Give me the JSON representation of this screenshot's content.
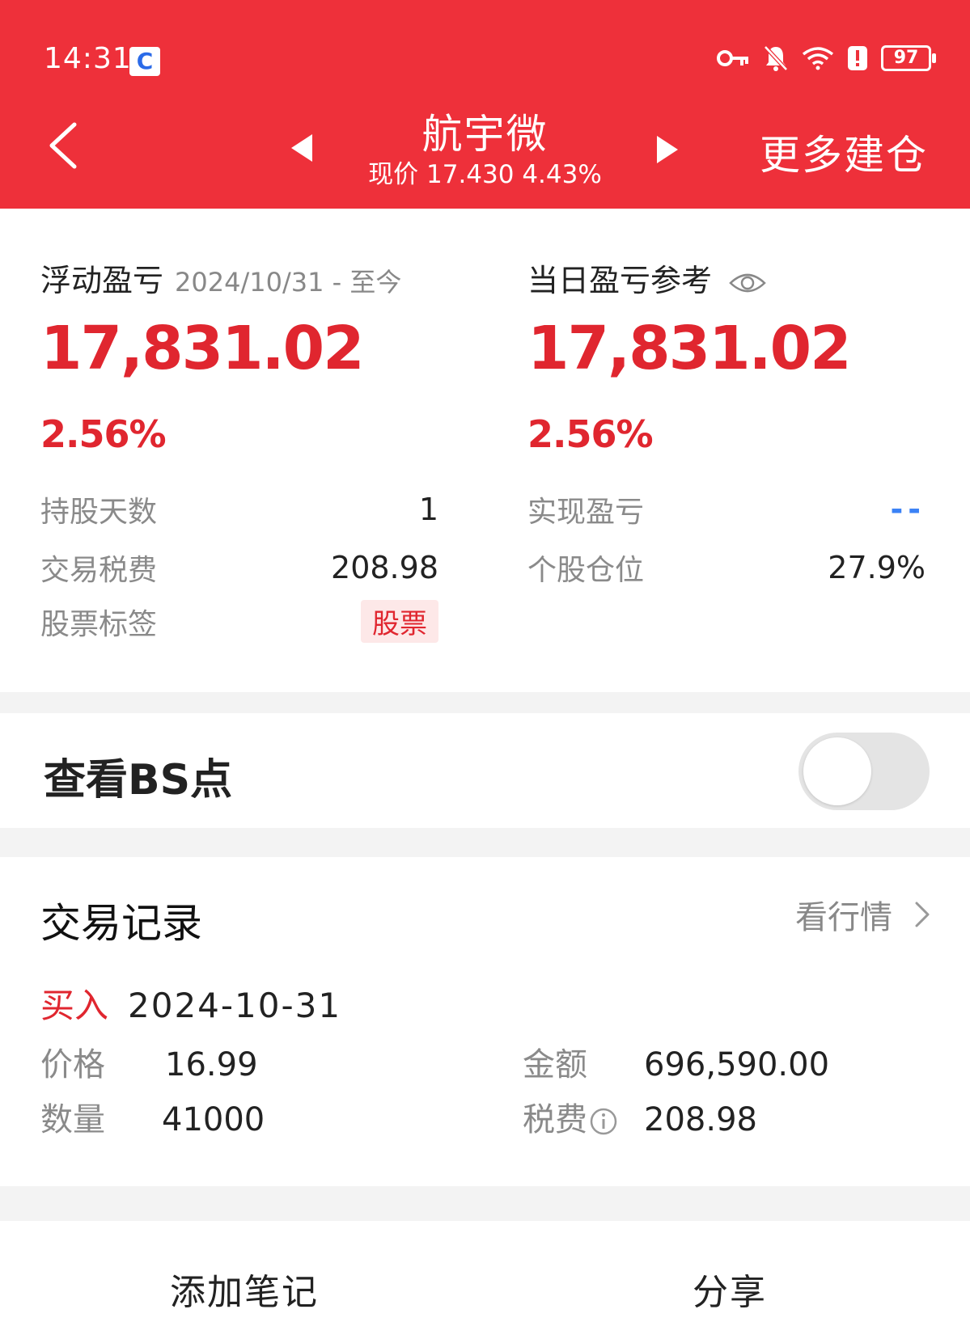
{
  "status_bar": {
    "time": "14:31",
    "app_icon": "C",
    "battery": "97"
  },
  "header": {
    "title": "航宇微",
    "subtitle": "现价 17.430 4.43%",
    "more_label": "更多建仓"
  },
  "pnl": {
    "floating_label": "浮动盈亏",
    "floating_date": "2024/10/31 - 至今",
    "floating_value": "17,831.02",
    "floating_pct": "2.56%",
    "daily_label": "当日盈亏参考",
    "daily_value": "17,831.02",
    "daily_pct": "2.56%"
  },
  "stats": {
    "hold_days_label": "持股天数",
    "hold_days_value": "1",
    "fee_label": "交易税费",
    "fee_value": "208.98",
    "tag_label": "股票标签",
    "tag_value": "股票",
    "realized_label": "实现盈亏",
    "realized_value": "--",
    "position_label": "个股仓位",
    "position_value": "27.9%"
  },
  "bs": {
    "label": "查看BS点",
    "enabled": false
  },
  "trade": {
    "title": "交易记录",
    "quote_link": "看行情",
    "side": "买入",
    "date": "2024-10-31",
    "price_label": "价格",
    "price_value": "16.99",
    "qty_label": "数量",
    "qty_value": "41000",
    "amount_label": "金额",
    "amount_value": "696,590.00",
    "tax_label": "税费",
    "tax_value": "208.98"
  },
  "bottom": {
    "add_note": "添加笔记",
    "share": "分享"
  },
  "colors": {
    "brand_red": "#ee303a",
    "value_red": "#e0262f",
    "link_blue": "#3b82f6"
  }
}
